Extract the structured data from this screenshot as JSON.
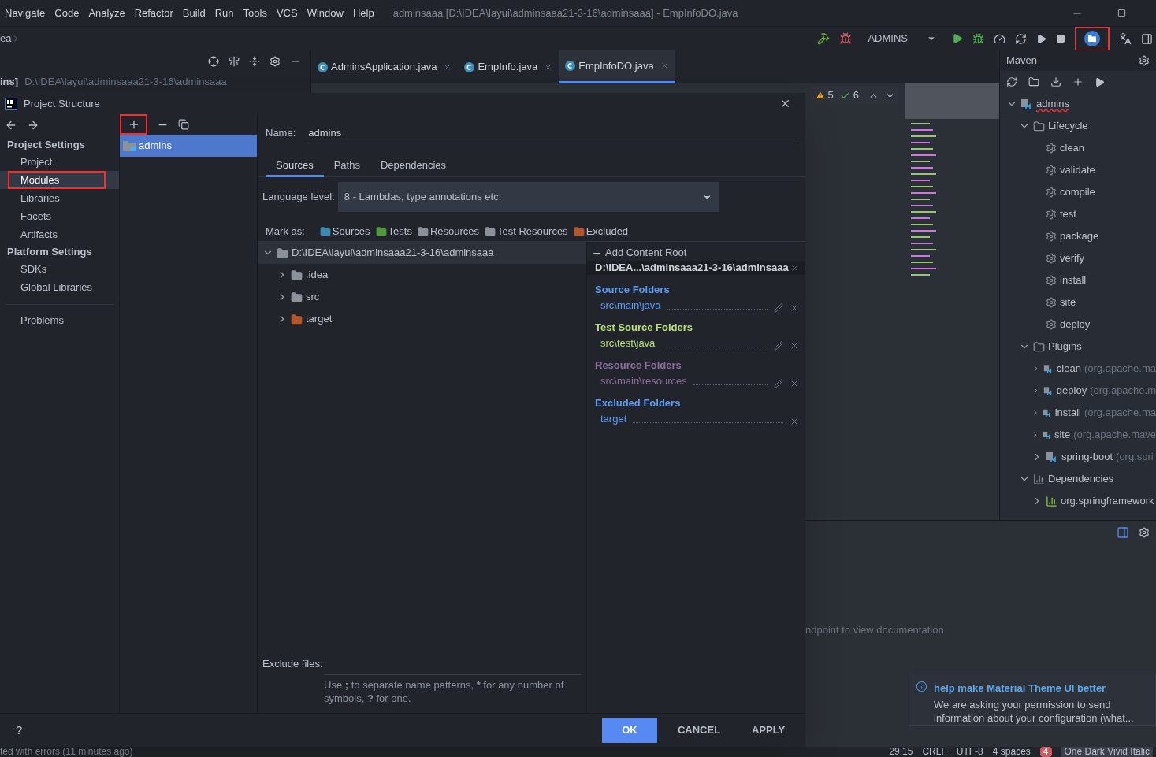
{
  "menu": {
    "items": [
      "Navigate",
      "Code",
      "Analyze",
      "Refactor",
      "Build",
      "Run",
      "Tools",
      "VCS",
      "Window",
      "Help"
    ],
    "window_title": "adminsaaa [D:\\IDEA\\layui\\adminsaaa21-3-16\\adminsaaa] - EmpInfoDO.java"
  },
  "toolbar": {
    "breadcrumb": "ea",
    "run_config": "ADMINS",
    "project_structure_highlighted": true
  },
  "project_panel": {
    "module": "ins]",
    "path": "D:\\IDEA\\layui\\adminsaaa21-3-16\\adminsaaa"
  },
  "editor_tabs": [
    {
      "label": "AdminsApplication.java",
      "selected": false
    },
    {
      "label": "EmpInfo.java",
      "selected": false
    },
    {
      "label": "EmpInfoDO.java",
      "selected": true
    }
  ],
  "inspections": {
    "warnings": "5",
    "passed": "6"
  },
  "maven": {
    "title": "Maven",
    "tree": [
      {
        "kind": "module",
        "label": "admins",
        "expanded": true,
        "children": [
          {
            "kind": "folder",
            "label": "Lifecycle",
            "expanded": true,
            "children": [
              {
                "kind": "goal",
                "label": "clean"
              },
              {
                "kind": "goal",
                "label": "validate"
              },
              {
                "kind": "goal",
                "label": "compile"
              },
              {
                "kind": "goal",
                "label": "test"
              },
              {
                "kind": "goal",
                "label": "package"
              },
              {
                "kind": "goal",
                "label": "verify"
              },
              {
                "kind": "goal",
                "label": "install"
              },
              {
                "kind": "goal",
                "label": "site"
              },
              {
                "kind": "goal",
                "label": "deploy"
              }
            ]
          },
          {
            "kind": "folder",
            "label": "Plugins",
            "expanded": true,
            "children": [
              {
                "kind": "plugin",
                "label": "clean",
                "detail": "(org.apache.ma",
                "expanded": false
              },
              {
                "kind": "plugin",
                "label": "deploy",
                "detail": "(org.apache.m",
                "expanded": false
              },
              {
                "kind": "plugin",
                "label": "install",
                "detail": "(org.apache.ma",
                "expanded": false
              },
              {
                "kind": "plugin",
                "label": "site",
                "detail": "(org.apache.mave",
                "expanded": false
              },
              {
                "kind": "plugin",
                "label": "spring-boot",
                "detail": "(org.spri",
                "expanded": false
              }
            ]
          },
          {
            "kind": "deps",
            "label": "Dependencies",
            "expanded": true,
            "children": [
              {
                "kind": "dependency",
                "label": "org.springframework",
                "expanded": false
              }
            ]
          }
        ]
      }
    ]
  },
  "dialog": {
    "title": "Project Structure",
    "nav": [
      {
        "heading": "Project Settings",
        "items": [
          {
            "label": "Project",
            "selected": false,
            "highlighted": false
          },
          {
            "label": "Modules",
            "selected": true,
            "highlighted": true
          },
          {
            "label": "Libraries",
            "selected": false,
            "highlighted": false
          },
          {
            "label": "Facets",
            "selected": false,
            "highlighted": false
          },
          {
            "label": "Artifacts",
            "selected": false,
            "highlighted": false
          }
        ]
      },
      {
        "heading": "Platform Settings",
        "items": [
          {
            "label": "SDKs",
            "selected": false,
            "highlighted": false
          },
          {
            "label": "Global Libraries",
            "selected": false,
            "highlighted": false
          }
        ]
      }
    ],
    "problems": "Problems",
    "add_highlighted": true,
    "modules": [
      {
        "label": "admins",
        "selected": true
      }
    ],
    "name_label": "Name:",
    "name_value": "admins",
    "tabs": [
      {
        "label": "Sources",
        "selected": true
      },
      {
        "label": "Paths",
        "selected": false
      },
      {
        "label": "Dependencies",
        "selected": false
      }
    ],
    "language_level_label": "Language level:",
    "language_level": "8 - Lambdas, type annotations etc.",
    "mark_as_label": "Mark as:",
    "mark_as": [
      {
        "label": "Sources",
        "color": "#3b8bb5"
      },
      {
        "label": "Tests",
        "color": "#4f9a3c"
      },
      {
        "label": "Resources",
        "color": "#8b929a"
      },
      {
        "label": "Test Resources",
        "color": "#8b929a"
      },
      {
        "label": "Excluded",
        "color": "#b5552a"
      }
    ],
    "tree": [
      {
        "label": "D:\\IDEA\\layui\\adminsaaa21-3-16\\adminsaaa",
        "color": "#8b929a",
        "expanded": true,
        "children": [
          {
            "label": ".idea",
            "color": "#8b929a",
            "expanded": false
          },
          {
            "label": "src",
            "color": "#8b929a",
            "expanded": false
          },
          {
            "label": "target",
            "color": "#b5552a",
            "expanded": false
          }
        ]
      }
    ],
    "add_content_root": "Add Content Root",
    "content_root": "D:\\IDEA...\\adminsaaa21-3-16\\adminsaaa",
    "folder_groups": [
      {
        "title": "Source Folders",
        "color": "#5e9cf5",
        "folders": [
          {
            "path": "src\\main\\java",
            "editable": true
          }
        ]
      },
      {
        "title": "Test Source Folders",
        "color": "#b9e07b",
        "folders": [
          {
            "path": "src\\test\\java",
            "editable": true
          }
        ]
      },
      {
        "title": "Resource Folders",
        "color": "#8b6f9d",
        "folders": [
          {
            "path": "src\\main\\resources",
            "editable": true
          }
        ]
      },
      {
        "title": "Excluded Folders",
        "color": "#5e9cf5",
        "folders": [
          {
            "path": "target",
            "editable": false
          }
        ]
      }
    ],
    "exclude_label": "Exclude files:",
    "exclude_hint": "Use **;** to separate name patterns, ***** for any number of symbols, **?** for one.",
    "help": "?",
    "buttons": [
      {
        "label": "OK",
        "kind": "primary"
      },
      {
        "label": "CANCEL",
        "kind": "plain"
      },
      {
        "label": "APPLY",
        "kind": "plain"
      }
    ]
  },
  "doc_hint": "ndpoint to view documentation",
  "notification": {
    "title": "help make Material Theme UI better",
    "body": "We are asking your permission to send information about your configuration (what..."
  },
  "status_bar": {
    "message": "ted with errors (11 minutes ago)",
    "position": "29:15",
    "line_ending": "CRLF",
    "encoding": "UTF-8",
    "indent": "4 spaces",
    "error_count": "4",
    "theme": "One Dark Vivid Italic"
  }
}
